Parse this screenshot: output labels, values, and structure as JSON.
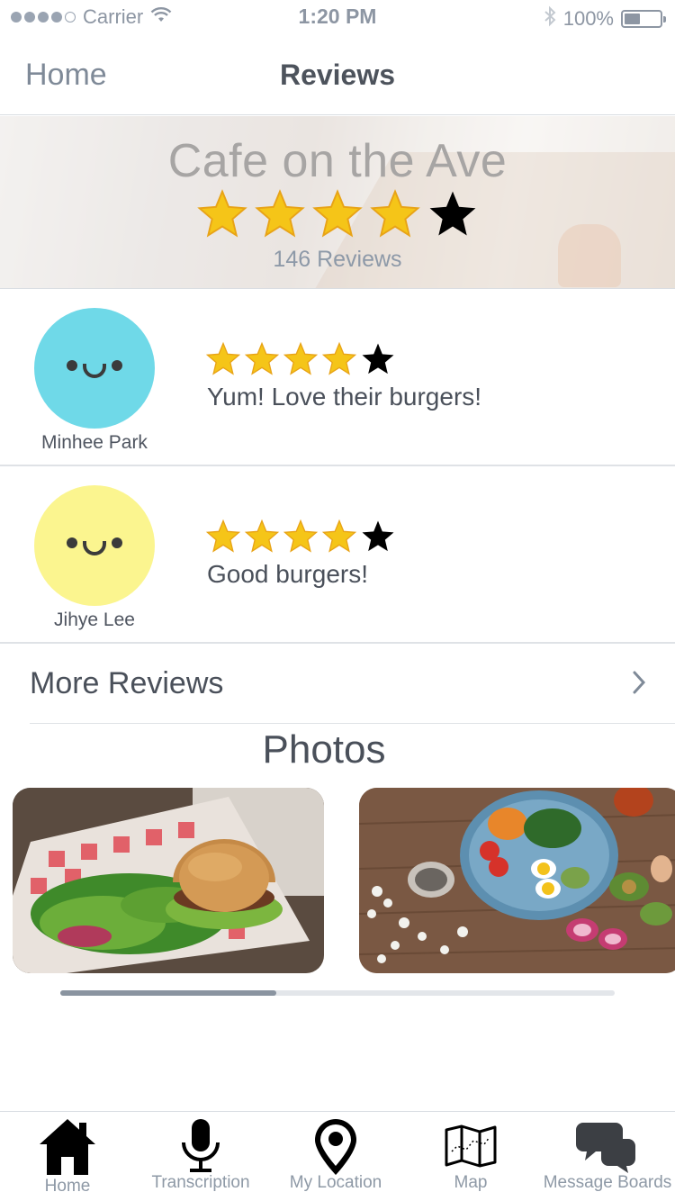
{
  "status_bar": {
    "carrier": "Carrier",
    "time": "1:20 PM",
    "battery": "100%",
    "signal_bars": 4,
    "battery_level": 0.45
  },
  "nav": {
    "back_label": "Home",
    "title": "Reviews"
  },
  "restaurant": {
    "name": "Cafe on the Ave",
    "rating": 4,
    "rating_max": 5,
    "review_count": "146 Reviews"
  },
  "reviews": [
    {
      "name": "Minhee Park",
      "rating": 4,
      "text": "Yum! Love their burgers!",
      "avatar_color": "#6fd9e8"
    },
    {
      "name": "Jihye Lee",
      "rating": 4,
      "text": "Good burgers!",
      "avatar_color": "#fbf58f"
    }
  ],
  "more_reviews": {
    "label": "More Reviews"
  },
  "photos": {
    "title": "Photos",
    "scroll_position": 0.39
  },
  "tabs": [
    {
      "label": "Home",
      "icon": "home-icon"
    },
    {
      "label": "Transcription",
      "icon": "microphone-icon"
    },
    {
      "label": "My Location",
      "icon": "location-pin-icon"
    },
    {
      "label": "Map",
      "icon": "map-icon"
    },
    {
      "label": "Message Boards",
      "icon": "chat-bubbles-icon"
    }
  ],
  "colors": {
    "star_filled": "#f5c518",
    "star_empty": "#000000",
    "accent_text": "#8d99a8"
  }
}
